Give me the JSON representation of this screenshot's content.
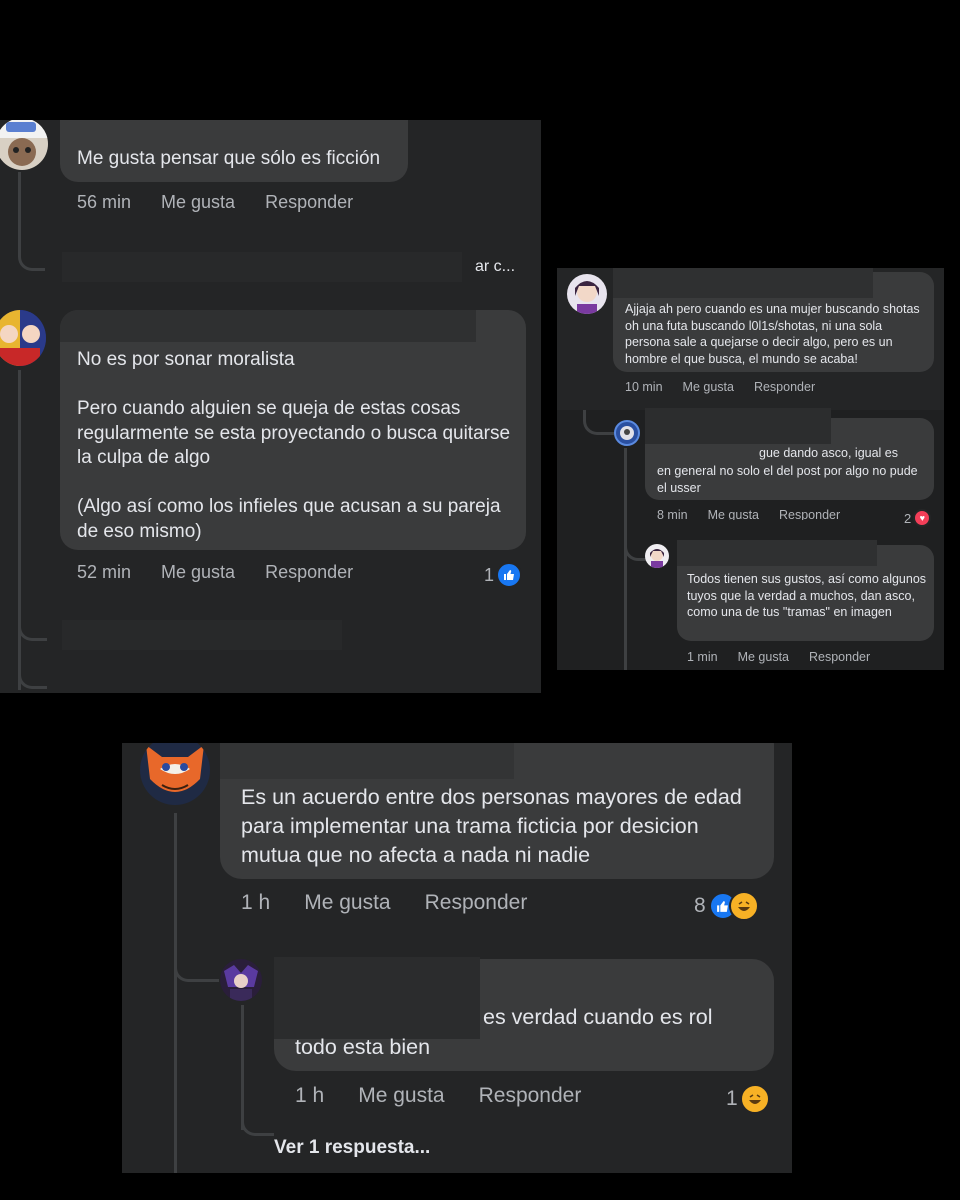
{
  "panel1": {
    "c1": {
      "text": "Me gusta pensar que sólo es ficción",
      "time": "56 min",
      "like": "Me gusta",
      "reply": "Responder"
    },
    "truncated": "ar c...",
    "c2": {
      "text": "No es por sonar moralista\n\nPero cuando alguien se queja de estas cosas regularmente se esta proyectando o busca quitarse la culpa de algo\n\n(Algo así como los infieles que acusan a su pareja de eso mismo)",
      "time": "52 min",
      "like": "Me gusta",
      "reply": "Responder",
      "reaction_count": "1"
    }
  },
  "panel2": {
    "c1": {
      "text": "Ajjaja ah pero cuando es una mujer buscando shotas oh una futa buscando l0l1s/shotas, ni una sola persona sale a quejarse o decir algo, pero es un hombre el que busca, el mundo se acaba!",
      "time": "10 min",
      "like": "Me gusta",
      "reply": "Responder"
    },
    "c2": {
      "text_line1": "gue dando asco, igual es",
      "text_rest": "en general no solo el del post por algo no pude el usser",
      "time": "8 min",
      "like": "Me gusta",
      "reply": "Responder",
      "reaction_count": "2"
    },
    "c3": {
      "text": "Todos tienen sus gustos, así como algunos tuyos que la verdad a muchos, dan asco, como una de tus \"tramas\" en imagen",
      "time": "1 min",
      "like": "Me gusta",
      "reply": "Responder"
    }
  },
  "panel3": {
    "c1": {
      "text": "Es un acuerdo entre dos personas mayores de edad para implementar una trama ficticia por desicion mutua que no afecta a nada ni nadie",
      "time": "1 h",
      "like": "Me gusta",
      "reply": "Responder",
      "reaction_count": "8"
    },
    "c2": {
      "text_line1": "es verdad cuando es rol",
      "text_line2": "todo esta bien",
      "time": "1 h",
      "like": "Me gusta",
      "reply": "Responder",
      "reaction_count": "1"
    },
    "more_replies": "Ver 1 respuesta..."
  },
  "icons": {
    "like": "thumbs-up-icon",
    "haha": "haha-emoji-icon",
    "love": "heart-icon"
  },
  "colors": {
    "panel_bg": "#242526",
    "bubble_bg": "#3a3b3c",
    "like_blue": "#1877f2",
    "haha_yellow": "#f7b125",
    "love_red": "#f33e58"
  }
}
